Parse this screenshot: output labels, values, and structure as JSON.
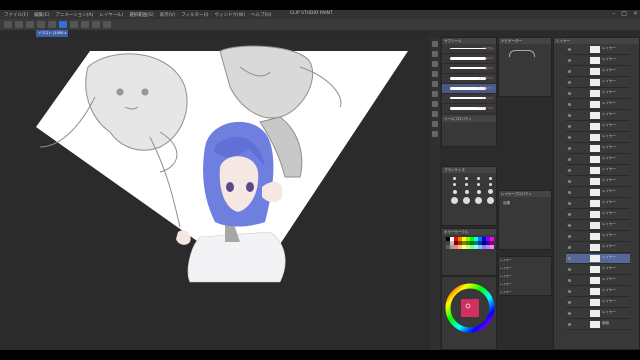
{
  "menu": {
    "items": [
      "ファイル(F)",
      "編集(E)",
      "アニメーション(A)",
      "レイヤー(L)",
      "選択範囲(S)",
      "表示(V)",
      "フィルター(I)",
      "ウィンドウ(W)",
      "ヘルプ(H)"
    ]
  },
  "window": {
    "title": "CLIP STUDIO PAINT",
    "controls": [
      "–",
      "□",
      "×"
    ]
  },
  "document_tab": {
    "label": "イラスト (1000 x 1000px)"
  },
  "sub_tool_panel": {
    "title": "サブツール",
    "brushes": [
      {
        "label": "カスタム"
      },
      {
        "label": "Gペン"
      },
      {
        "label": "丸ペン"
      },
      {
        "label": "カブラペン"
      },
      {
        "label": "リアルGペン",
        "selected": true
      },
      {
        "label": "ミリペン"
      },
      {
        "label": "テーパーペン"
      }
    ],
    "footer": "ツールプロパティ"
  },
  "brush_size_panel": {
    "title": "ブラシサイズ"
  },
  "color_panel": {
    "title": "カラーサークル",
    "accent": "#2f6fd6",
    "swatches": [
      "#000000",
      "#ffffff",
      "#ff0000",
      "#ff8000",
      "#ffff00",
      "#80ff00",
      "#00ff00",
      "#00ffff",
      "#0080ff",
      "#0000ff",
      "#8000ff",
      "#ff00ff",
      "#404040",
      "#c0c0c0",
      "#800000",
      "#804000",
      "#808000",
      "#408000",
      "#008000",
      "#008080",
      "#004080",
      "#000080",
      "#400080",
      "#800080",
      "#606060",
      "#a0a0a0",
      "#ff8080",
      "#ffc080",
      "#ffff80",
      "#c0ff80",
      "#80ff80",
      "#80ffff",
      "#80c0ff",
      "#8080ff",
      "#c080ff",
      "#ff80ff"
    ]
  },
  "nav_panel": {
    "title": "ナビゲーター"
  },
  "layer_props": {
    "title": "レイヤープロパティ",
    "label": "効果"
  },
  "layer_panel": {
    "title": "レイヤー",
    "layers": [
      {
        "name": "レイヤー"
      },
      {
        "name": "レイヤー"
      },
      {
        "name": "レイヤー"
      },
      {
        "name": "レイヤー"
      },
      {
        "name": "レイヤー"
      },
      {
        "name": "レイヤー"
      },
      {
        "name": "レイヤー"
      },
      {
        "name": "レイヤー"
      },
      {
        "name": "レイヤー"
      },
      {
        "name": "レイヤー"
      },
      {
        "name": "レイヤー"
      },
      {
        "name": "レイヤー"
      },
      {
        "name": "レイヤー"
      },
      {
        "name": "レイヤー"
      },
      {
        "name": "レイヤー"
      },
      {
        "name": "レイヤー"
      },
      {
        "name": "レイヤー"
      },
      {
        "name": "レイヤー"
      },
      {
        "name": "レイヤー"
      },
      {
        "name": "レイヤー",
        "selected": true
      },
      {
        "name": "レイヤー"
      },
      {
        "name": "レイヤー"
      },
      {
        "name": "レイヤー"
      },
      {
        "name": "レイヤー"
      },
      {
        "name": "レイヤー"
      },
      {
        "name": "用紙"
      }
    ]
  },
  "mini_layer_panel": {
    "rows": [
      "レイヤー",
      "レイヤー",
      "レイヤー",
      "レイヤー",
      "レイヤー"
    ]
  },
  "colors": {
    "hair": "#6f7fe0",
    "canvas": "#ffffff",
    "sketch": "#9a9a9a"
  }
}
